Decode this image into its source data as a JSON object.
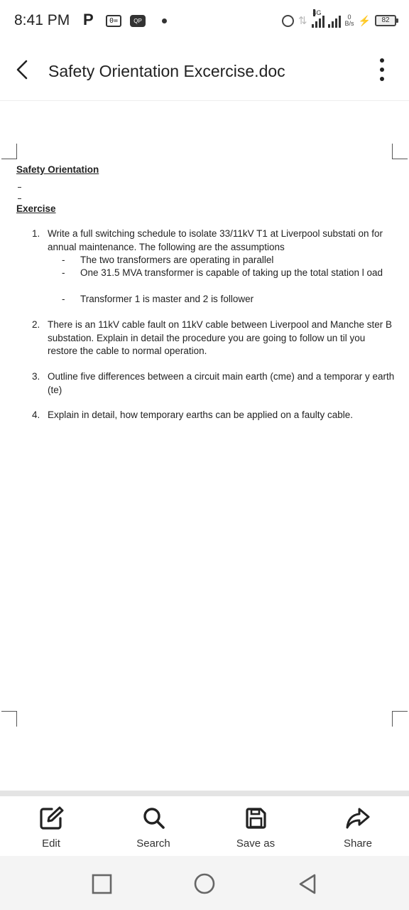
{
  "status_bar": {
    "time": "8:41 PM",
    "app_letter": "P",
    "network": "4G",
    "speed_value": "0",
    "speed_unit": "B/s",
    "battery": "82"
  },
  "app_bar": {
    "title": "Safety Orientation Excercise.doc"
  },
  "document": {
    "heading1": "Safety Orientation",
    "heading2": "Exercise",
    "questions": [
      {
        "number": "1.",
        "text": "Write a full switching schedule to isolate 33/11kV T1 at Liverpool substati on for annual maintenance. The following are the assumptions",
        "sub_items": [
          {
            "bullet": "-",
            "text": "The two transformers are operating in parallel"
          },
          {
            "bullet": "-",
            "text": "One 31.5 MVA transformer is capable of taking up the total station l oad"
          },
          {
            "bullet": "-",
            "text": "Transformer 1 is master and 2 is follower"
          }
        ]
      },
      {
        "number": "2.",
        "text": "There is an 11kV cable fault on 11kV cable between Liverpool and Manche ster B substation. Explain in detail the procedure you are going to follow un til you restore the cable to normal operation."
      },
      {
        "number": "3.",
        "text": "Outline five differences between a circuit main earth (cme) and a temporar y earth (te)"
      },
      {
        "number": "4.",
        "text": "Explain in detail, how temporary earths can be applied on a faulty cable."
      }
    ]
  },
  "toolbar": {
    "edit_label": "Edit",
    "search_label": "Search",
    "save_as_label": "Save as",
    "share_label": "Share"
  },
  "icons": {
    "back": "chevron-left-icon",
    "more": "more-vertical-icon",
    "edit": "edit-icon",
    "search": "search-icon",
    "save_as": "save-icon",
    "share": "share-icon",
    "nav_recents": "square-icon",
    "nav_home": "circle-icon",
    "nav_back": "triangle-back-icon"
  }
}
